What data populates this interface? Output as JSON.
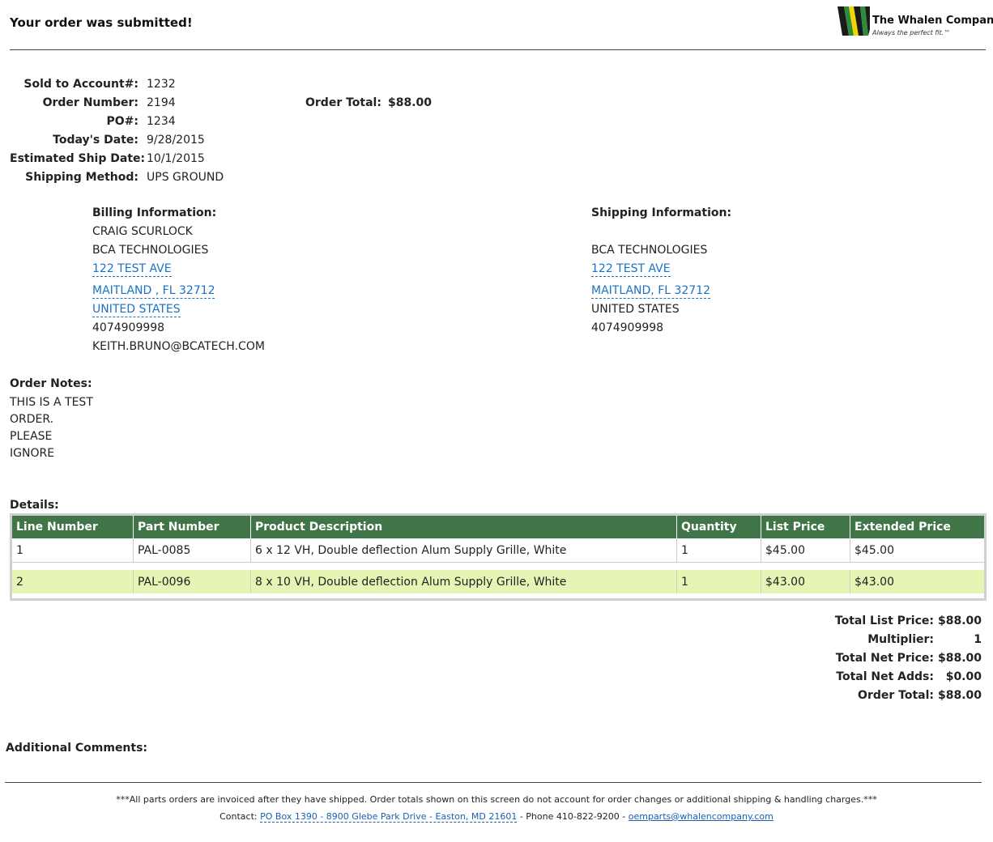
{
  "header": {
    "title": "Your order was submitted!",
    "logo_name": "The Whalen Company",
    "logo_tagline": "Always the perfect fit.™"
  },
  "order": {
    "sold_to_label": "Sold to Account#:",
    "sold_to": "1232",
    "order_number_label": "Order Number:",
    "order_number": "2194",
    "po_label": "PO#:",
    "po": "1234",
    "todays_date_label": "Today's Date:",
    "todays_date": "9/28/2015",
    "ship_date_label": "Estimated Ship Date:",
    "ship_date": "10/1/2015",
    "shipping_method_label": "Shipping Method:",
    "shipping_method": "UPS GROUND",
    "order_total_label": "Order Total:",
    "order_total": "$88.00"
  },
  "billing": {
    "heading": "Billing Information:",
    "name": "CRAIG SCURLOCK",
    "company": "BCA TECHNOLOGIES",
    "street": "122 TEST AVE",
    "city_state": "MAITLAND , FL 32712",
    "country": "UNITED STATES",
    "phone": "4074909998",
    "email": "KEITH.BRUNO@BCATECH.COM"
  },
  "shipping": {
    "heading": "Shipping Information:",
    "company": "BCA TECHNOLOGIES",
    "street": "122 TEST AVE",
    "city_state": "MAITLAND, FL 32712",
    "country": "UNITED STATES",
    "phone": "4074909998"
  },
  "notes": {
    "heading": "Order Notes:",
    "lines": [
      "THIS IS A TEST",
      "ORDER.",
      "PLEASE",
      "IGNORE"
    ]
  },
  "details": {
    "heading": "Details:",
    "columns": [
      "Line Number",
      "Part Number",
      "Product Description",
      "Quantity",
      "List Price",
      "Extended Price"
    ],
    "rows": [
      [
        "1",
        "PAL-0085",
        "6 x 12 VH, Double deflection Alum Supply Grille, White",
        "1",
        "$45.00",
        "$45.00"
      ],
      [
        "2",
        "PAL-0096",
        "8 x 10 VH, Double deflection Alum Supply Grille, White",
        "1",
        "$43.00",
        "$43.00"
      ]
    ]
  },
  "totals": {
    "total_list_label": "Total List Price:",
    "total_list": "$88.00",
    "multiplier_label": "Multiplier:",
    "multiplier": "1",
    "total_net_label": "Total Net Price:",
    "total_net": "$88.00",
    "net_adds_label": "Total Net Adds:",
    "net_adds": "$0.00",
    "order_total_label": "Order Total:",
    "order_total": "$88.00"
  },
  "comments": {
    "heading": "Additional Comments:"
  },
  "footer": {
    "disclaimer": "***All parts orders are invoiced after they have shipped. Order totals shown on this screen do not account for order changes or additional shipping & handling charges.***",
    "contact_prefix": "Contact: ",
    "address": "PO Box 1390 - 8900 Glebe Park Drive - Easton, MD 21601",
    "phone_text": " - Phone 410-822-9200 - ",
    "email": "oemparts@whalencompany.com"
  }
}
